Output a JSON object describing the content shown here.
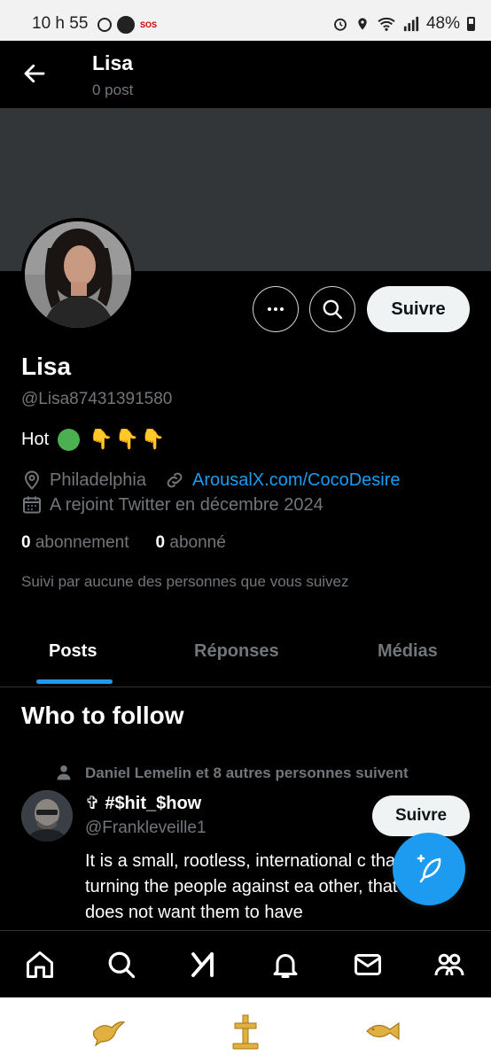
{
  "status_bar": {
    "time": "10 h 55",
    "sos": "SOS",
    "battery": "48%"
  },
  "header": {
    "name": "Lisa",
    "post_count": "0 post"
  },
  "profile": {
    "name": "Lisa",
    "handle": "@Lisa87431391580",
    "bio_text": "Hot",
    "bio_emoji": "👇👇👇",
    "location": "Philadelphia",
    "website": "ArousalX.com/CocoDesire",
    "joined": "A rejoint Twitter en décembre 2024",
    "following_count": "0",
    "following_label": "abonnement",
    "followers_count": "0",
    "followers_label": "abonné",
    "followed_by": "Suivi par aucune des personnes que vous suivez",
    "follow_button": "Suivre"
  },
  "tabs": [
    {
      "label": "Posts"
    },
    {
      "label": "Réponses"
    },
    {
      "label": "Médias"
    }
  ],
  "who_to_follow": {
    "title": "Who to follow",
    "social_context": "Daniel Lemelin et 8 autres personnes suivent",
    "name": "✞ #$hit_$how",
    "handle": "@Frankleveille1",
    "follow_button": "Suivre",
    "text": "It is a small, rootless, international c that is turning the people against ea other, that does not want them to have"
  },
  "colors": {
    "accent": "#1d9bf0",
    "background": "#000000",
    "banner": "#333639",
    "muted": "#71767b"
  },
  "icons": {
    "bottom_nav": [
      "home-icon",
      "search-icon",
      "grok-icon",
      "notifications-icon",
      "messages-icon",
      "communities-icon"
    ],
    "system_bar": [
      "dove-icon",
      "cross-icon",
      "fish-icon"
    ]
  }
}
